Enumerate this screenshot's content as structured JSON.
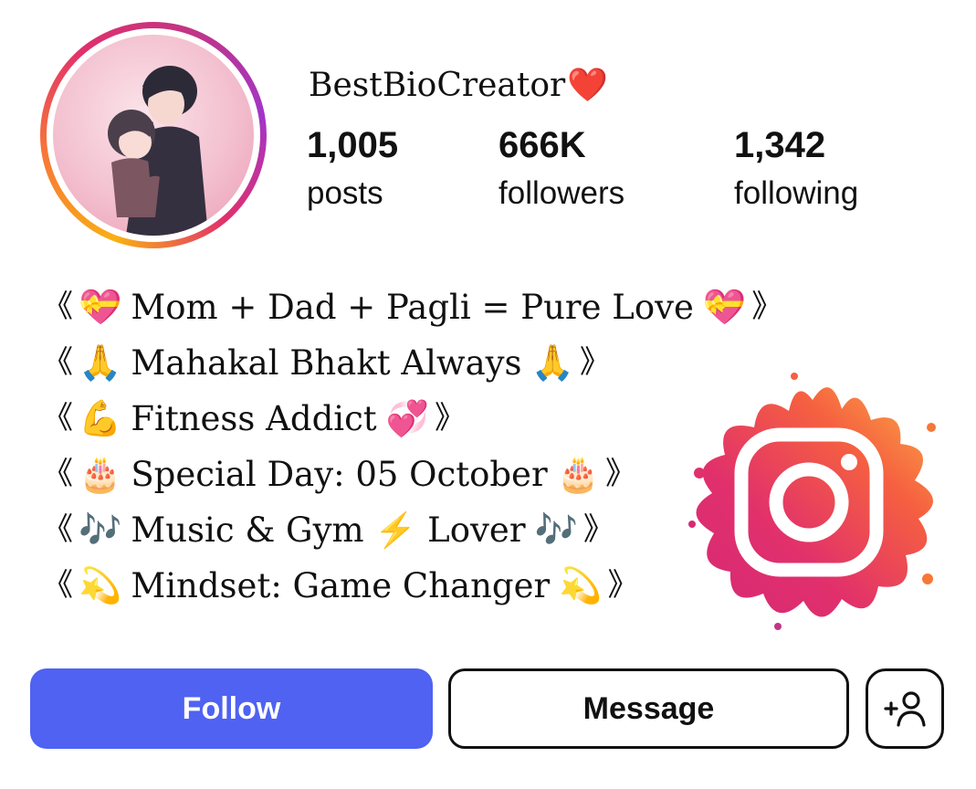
{
  "profile": {
    "username": "BestBioCreator",
    "username_emoji": "❤️",
    "stats": [
      {
        "value": "1,005",
        "label": "posts"
      },
      {
        "value": "666K",
        "label": "followers"
      },
      {
        "value": "1,342",
        "label": "following"
      }
    ]
  },
  "bio": {
    "open_bracket": "《",
    "close_bracket": "》",
    "lines": [
      {
        "emoji_start": "💝",
        "text": "Mom + Dad + Pagli = Pure Love",
        "emoji_end": "💝"
      },
      {
        "emoji_start": "🙏",
        "text": "Mahakal Bhakt Always",
        "emoji_end": "🙏"
      },
      {
        "emoji_start": "💪",
        "text": "Fitness Addict",
        "emoji_end": "💞"
      },
      {
        "emoji_start": "🎂",
        "text": "Special Day: 05 October",
        "emoji_end": "🎂"
      },
      {
        "emoji_start": "🎶",
        "text": "Music & Gym ⚡ Lover",
        "emoji_end": "🎶"
      },
      {
        "emoji_start": "💫",
        "text": "Mindset: Game Changer",
        "emoji_end": "💫"
      }
    ]
  },
  "actions": {
    "follow_label": "Follow",
    "message_label": "Message",
    "add_icon": "add-person-icon"
  },
  "colors": {
    "follow_button": "#4f62f2",
    "ring_gradient": [
      "#f9b013",
      "#f77737",
      "#e1306c",
      "#c13584"
    ]
  },
  "icons": [
    "instagram-logo",
    "add-person-icon"
  ]
}
